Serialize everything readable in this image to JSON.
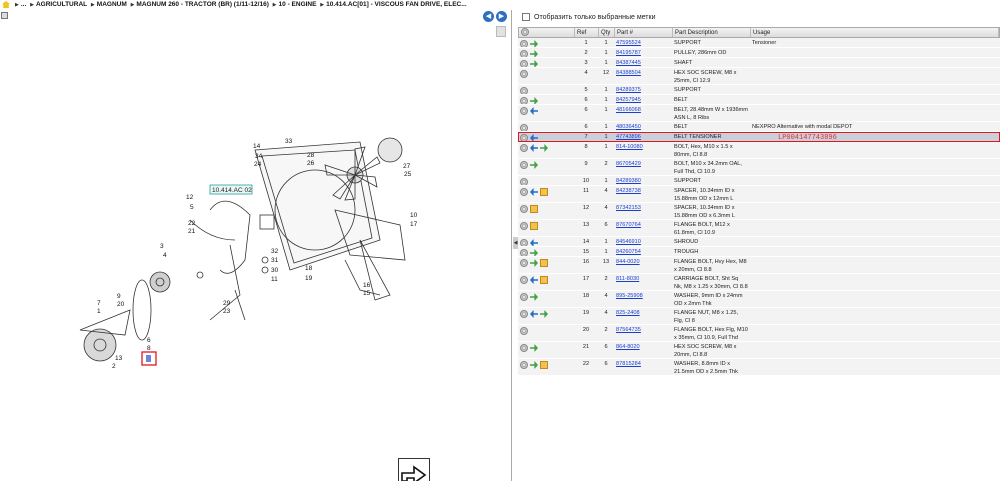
{
  "breadcrumb": [
    "...",
    "AGRICULTURAL",
    "MAGNUM",
    "MAGNUM 260 - TRACTOR (BR) (1/11-12/16)",
    "10 - ENGINE",
    "10.414.AC[01] - VISCOUS FAN DRIVE, ELEC..."
  ],
  "drawing": {
    "callout": "10.414.AC 02",
    "labels": [
      "33",
      "14",
      "34",
      "24",
      "28",
      "26",
      "25",
      "27",
      "12",
      "5",
      "22",
      "21",
      "3",
      "4",
      "32",
      "31",
      "30",
      "11",
      "18",
      "19",
      "10",
      "17",
      "9",
      "20",
      "7",
      "1",
      "29",
      "23",
      "16",
      "15",
      "6",
      "8",
      "13",
      "2"
    ]
  },
  "filter": {
    "label": "Отобразить только выбранные метки"
  },
  "columns": {
    "ref": "Ref",
    "qty": "Qty",
    "part": "Part #",
    "desc": "Part Description",
    "usage": "Usage"
  },
  "selected_note": "LP004147743896",
  "rows": [
    {
      "ref": "1",
      "qty": "1",
      "part": "47595524",
      "desc": "SUPPORT",
      "usage": "Tensioner",
      "icons": [
        "eye",
        "green"
      ]
    },
    {
      "ref": "2",
      "qty": "1",
      "part": "84195787",
      "desc": "PULLEY, 286mm OD",
      "usage": "",
      "icons": [
        "eye",
        "green"
      ]
    },
    {
      "ref": "3",
      "qty": "1",
      "part": "84387445",
      "desc": "SHAFT",
      "usage": "",
      "icons": [
        "eye",
        "green"
      ]
    },
    {
      "ref": "4",
      "qty": "12",
      "part": "84388504",
      "desc": "HEX SOC SCREW, M8 x 25mm, Cl 12.9",
      "usage": "",
      "icons": [
        "eye"
      ]
    },
    {
      "ref": "5",
      "qty": "1",
      "part": "84289375",
      "desc": "SUPPORT",
      "usage": "",
      "icons": [
        "eye"
      ]
    },
    {
      "ref": "6",
      "qty": "1",
      "part": "84257945",
      "desc": "BELT",
      "usage": "",
      "icons": [
        "eye",
        "green"
      ]
    },
    {
      "ref": "6",
      "qty": "1",
      "part": "48166068",
      "desc": "BELT, 28.48mm W x 1936mm ASN L, 8 Ribs",
      "usage": "",
      "icons": [
        "eye",
        "blue"
      ]
    },
    {
      "ref": "6",
      "qty": "1",
      "part": "48036450",
      "desc": "BELT",
      "usage": "NEXPRO Alternative with modal DEPOT",
      "icons": [
        "eye"
      ]
    },
    {
      "ref": "7",
      "qty": "1",
      "part": "47743896",
      "desc": "BELT TENSIONER",
      "usage": "",
      "icons": [
        "eye",
        "blue"
      ],
      "selected": true
    },
    {
      "ref": "8",
      "qty": "1",
      "part": "814-10080",
      "desc": "BOLT, Hex, M10 x 1.5 x 80mm, Cl 8.8",
      "usage": "",
      "icons": [
        "eye",
        "blue",
        "green"
      ]
    },
    {
      "ref": "9",
      "qty": "2",
      "part": "86705429",
      "desc": "BOLT, M10 x 34.2mm OAL, Full Thd, Cl 10.9",
      "usage": "",
      "icons": [
        "eye",
        "green"
      ]
    },
    {
      "ref": "10",
      "qty": "1",
      "part": "84289380",
      "desc": "SUPPORT",
      "usage": "",
      "icons": [
        "eye"
      ]
    },
    {
      "ref": "11",
      "qty": "4",
      "part": "84238738",
      "desc": "SPACER, 10.34mm ID x 15.88mm OD x 12mm L",
      "usage": "",
      "icons": [
        "eye",
        "blue",
        "box"
      ]
    },
    {
      "ref": "12",
      "qty": "4",
      "part": "87342153",
      "desc": "SPACER, 10.34mm ID x 15.88mm OD x 6.3mm L",
      "usage": "",
      "icons": [
        "eye",
        "box"
      ]
    },
    {
      "ref": "13",
      "qty": "6",
      "part": "87670764",
      "desc": "FLANGE BOLT, M12 x 61.8mm, Cl 10.9",
      "usage": "",
      "icons": [
        "eye",
        "box"
      ]
    },
    {
      "ref": "14",
      "qty": "1",
      "part": "84546910",
      "desc": "SHROUD",
      "usage": "",
      "icons": [
        "eye",
        "blue"
      ]
    },
    {
      "ref": "15",
      "qty": "1",
      "part": "84260754",
      "desc": "TROUGH",
      "usage": "",
      "icons": [
        "eye",
        "green"
      ]
    },
    {
      "ref": "16",
      "qty": "13",
      "part": "844-0020",
      "desc": "FLANGE BOLT, Hvy Hex, M8 x 20mm, Cl 8.8",
      "usage": "",
      "icons": [
        "eye",
        "green",
        "box"
      ]
    },
    {
      "ref": "17",
      "qty": "2",
      "part": "811-8030",
      "desc": "CARRIAGE BOLT, Sht Sq Nk, M8 x 1.25 x 30mm, Cl 8.8",
      "usage": "",
      "icons": [
        "eye",
        "blue",
        "box"
      ]
    },
    {
      "ref": "18",
      "qty": "4",
      "part": "895-25908",
      "desc": "WASHER, 9mm ID x 24mm OD x 2mm Thk",
      "usage": "",
      "icons": [
        "eye",
        "green"
      ]
    },
    {
      "ref": "19",
      "qty": "4",
      "part": "825-2408",
      "desc": "FLANGE NUT, M8 x 1.25, Flg, Cl 8",
      "usage": "",
      "icons": [
        "eye",
        "blue",
        "green"
      ]
    },
    {
      "ref": "20",
      "qty": "2",
      "part": "87564735",
      "desc": "FLANGE BOLT, Hex Flg, M10 x 35mm, Cl 10.9, Full Thd",
      "usage": "",
      "icons": [
        "eye"
      ]
    },
    {
      "ref": "21",
      "qty": "6",
      "part": "864-8020",
      "desc": "HEX SOC SCREW, M8 x 20mm, Cl 8.8",
      "usage": "",
      "icons": [
        "eye",
        "green"
      ]
    },
    {
      "ref": "22",
      "qty": "6",
      "part": "87815284",
      "desc": "WASHER, 8.8mm ID x 21.5mm OD x 2.5mm Thk",
      "usage": "",
      "icons": [
        "eye",
        "green",
        "box"
      ]
    }
  ]
}
